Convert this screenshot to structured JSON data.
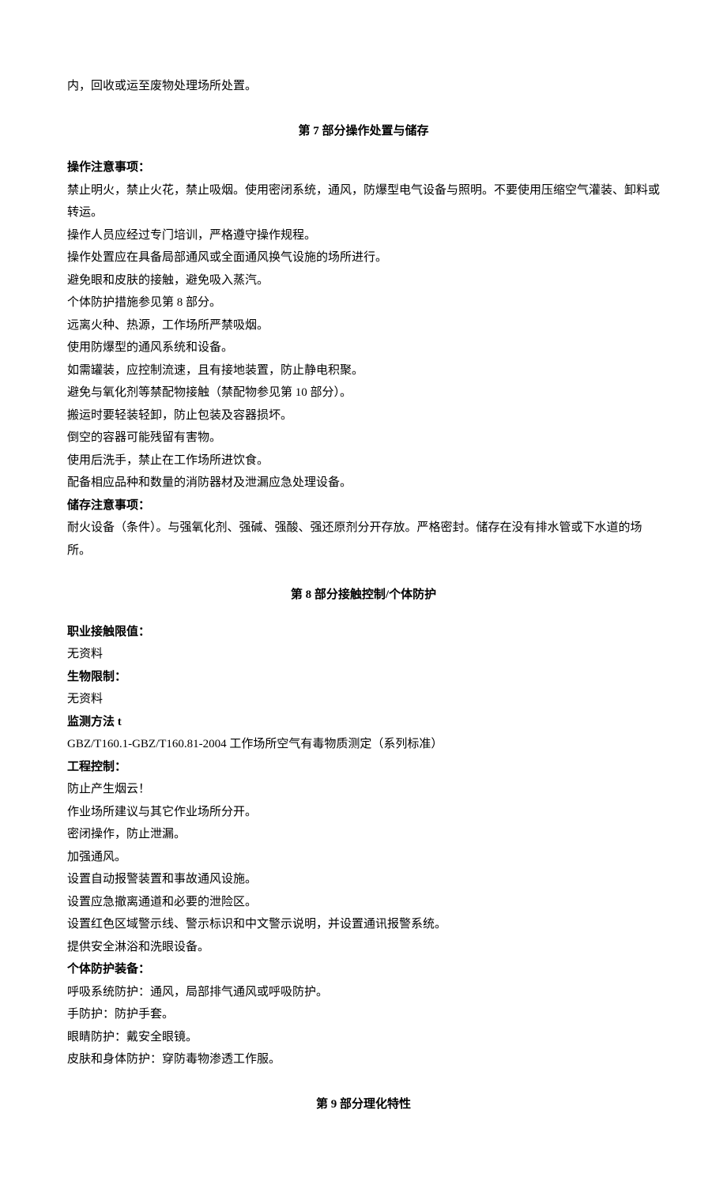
{
  "intro": {
    "line1": "内，回收或运至废物处理场所处置。"
  },
  "section7": {
    "title": "第 7 部分操作处置与储存",
    "op_heading": "操作注意事项：",
    "op_lines": [
      "禁止明火，禁止火花，禁止吸烟。使用密闭系统，通风，防爆型电气设备与照明。不要使用压缩空气灌装、卸料或转运。",
      "操作人员应经过专门培训，严格遵守操作规程。",
      "操作处置应在具备局部通风或全面通风换气设施的场所进行。",
      "避免眼和皮肤的接触，避免吸入蒸汽。",
      "个体防护措施参见第 8 部分。",
      "远离火种、热源，工作场所严禁吸烟。",
      "使用防爆型的通风系统和设备。",
      "如需罐装，应控制流速，且有接地装置，防止静电积聚。",
      "避免与氧化剂等禁配物接触（禁配物参见第 10 部分）。",
      "搬运时要轻装轻卸，防止包装及容器损坏。",
      "倒空的容器可能残留有害物。",
      "使用后洗手，禁止在工作场所进饮食。",
      "配备相应品种和数量的消防器材及泄漏应急处理设备。"
    ],
    "store_heading": "储存注意事项：",
    "store_lines": [
      "耐火设备（条件）。与强氧化剂、强碱、强酸、强还原剂分开存放。严格密封。储存在没有排水管或下水道的场所。"
    ]
  },
  "section8": {
    "title": "第 8 部分接触控制/个体防护",
    "exp_heading": "职业接触限值：",
    "exp_value": "无资料",
    "bio_heading": "生物限制：",
    "bio_value": "无资料",
    "mon_heading": "监测方法 t",
    "mon_value": "GBZ/T160.1-GBZ/T160.81-2004 工作场所空气有毒物质测定（系列标准）",
    "eng_heading": "工程控制：",
    "eng_lines": [
      "防止产生烟云！",
      "作业场所建议与其它作业场所分开。",
      "密闭操作，防止泄漏。",
      "加强通风。",
      "设置自动报警装置和事故通风设施。",
      "设置应急撤离通道和必要的泄险区。",
      "设置红色区域警示线、警示标识和中文警示说明，并设置通讯报警系统。",
      "提供安全淋浴和洗眼设备。"
    ],
    "ppe_heading": "个体防护装备：",
    "ppe_lines": [
      "呼吸系统防护：通风，局部排气通风或呼吸防护。",
      "手防护：防护手套。",
      "眼睛防护：戴安全眼镜。",
      "皮肤和身体防护：穿防毒物渗透工作服。"
    ]
  },
  "section9": {
    "title": "第 9 部分理化特性"
  }
}
